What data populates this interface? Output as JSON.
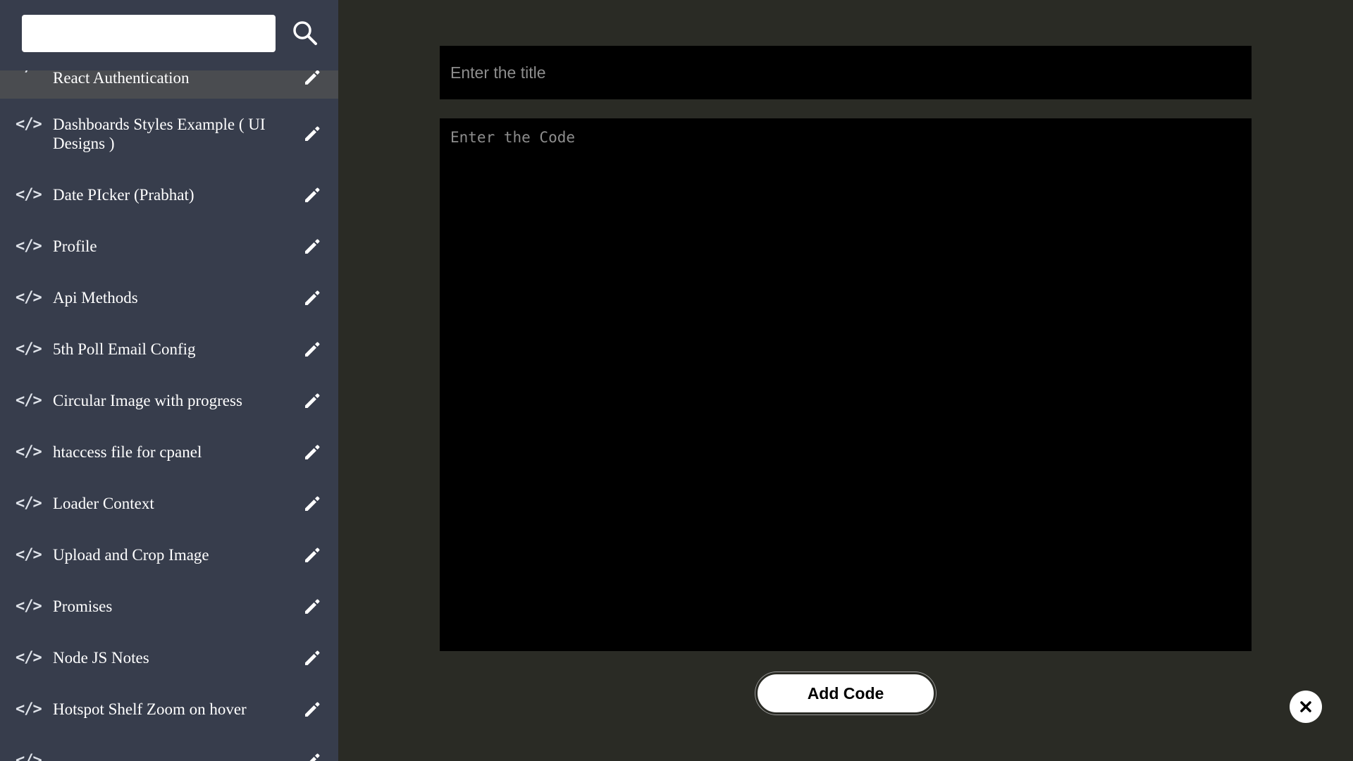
{
  "search": {
    "placeholder": "",
    "value": "",
    "icon": "search-icon"
  },
  "sidebar": {
    "items": [
      {
        "label": "React Authentication",
        "icon": "code-icon",
        "action_icon": "pencil-icon"
      },
      {
        "label": "Dashboards Styles Example ( UI Designs )",
        "icon": "code-icon",
        "action_icon": "pencil-icon"
      },
      {
        "label": "Date PIcker (Prabhat)",
        "icon": "code-icon",
        "action_icon": "pencil-icon"
      },
      {
        "label": "Profile",
        "icon": "code-icon",
        "action_icon": "pencil-icon"
      },
      {
        "label": "Api Methods",
        "icon": "code-icon",
        "action_icon": "pencil-icon"
      },
      {
        "label": "5th Poll Email Config",
        "icon": "code-icon",
        "action_icon": "pencil-icon"
      },
      {
        "label": "Circular Image with progress",
        "icon": "code-icon",
        "action_icon": "pencil-icon"
      },
      {
        "label": "htaccess file for cpanel",
        "icon": "code-icon",
        "action_icon": "pencil-icon"
      },
      {
        "label": "Loader Context",
        "icon": "code-icon",
        "action_icon": "pencil-icon"
      },
      {
        "label": "Upload and Crop Image",
        "icon": "code-icon",
        "action_icon": "pencil-icon"
      },
      {
        "label": "Promises",
        "icon": "code-icon",
        "action_icon": "pencil-icon"
      },
      {
        "label": "Node JS Notes",
        "icon": "code-icon",
        "action_icon": "pencil-icon"
      },
      {
        "label": "Hotspot Shelf Zoom on hover",
        "icon": "code-icon",
        "action_icon": "pencil-icon"
      },
      {
        "label": "",
        "icon": "code-icon",
        "action_icon": "pencil-icon"
      }
    ],
    "code_glyph": "</>"
  },
  "editor": {
    "title_placeholder": "Enter the title",
    "code_placeholder": "Enter the Code",
    "submit_label": "Add Code"
  },
  "close": {
    "icon": "close-icon"
  },
  "colors": {
    "sidebar_bg": "#373d4c",
    "main_bg": "#2a2b25",
    "input_bg": "#000000",
    "placeholder": "#8d8d8d"
  }
}
